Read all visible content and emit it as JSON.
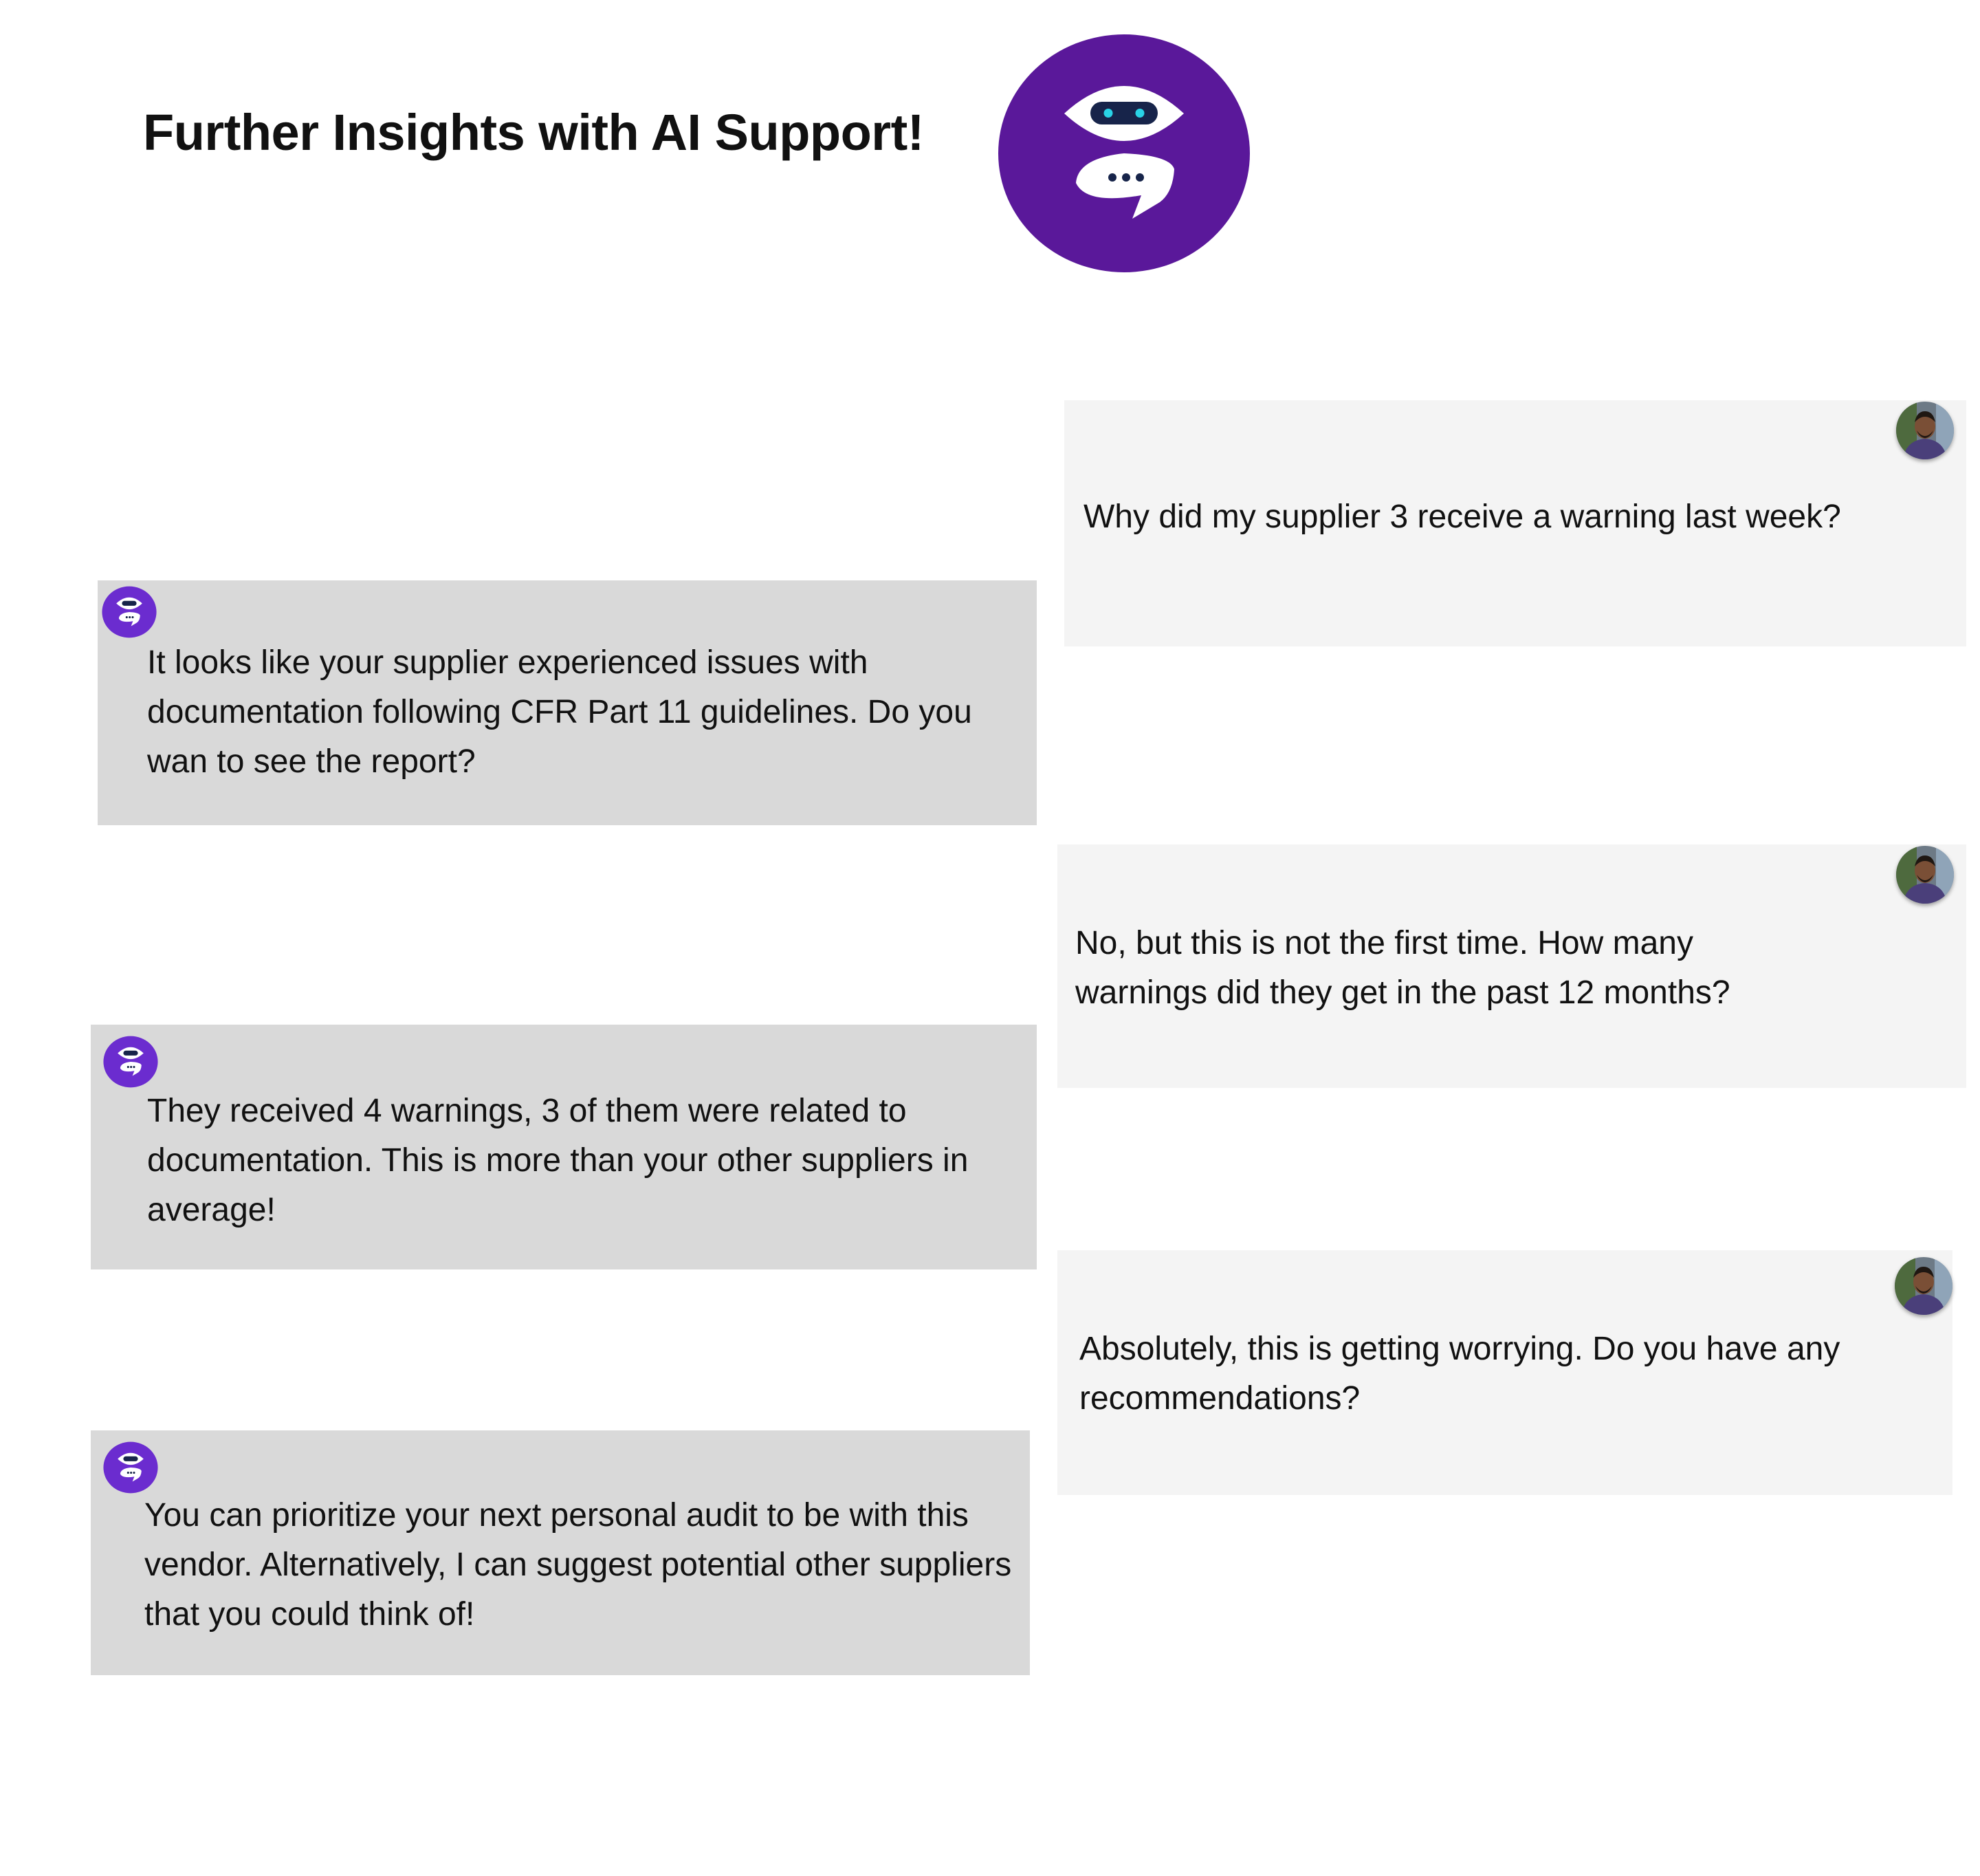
{
  "header": {
    "title": "Further Insights with AI Support!",
    "logo_icon": "chatbot-robot-icon",
    "brand_color": "#5a189a"
  },
  "conversation": {
    "messages": [
      {
        "role": "user",
        "avatar_icon": "user-photo-avatar",
        "text": "Why did my supplier 3 receive a warning last week?"
      },
      {
        "role": "assistant",
        "avatar_icon": "chatbot-robot-icon",
        "text": "It looks like your supplier experienced issues with documentation following CFR Part 11 guidelines. Do you wan to see the report?"
      },
      {
        "role": "user",
        "avatar_icon": "user-photo-avatar",
        "text": "No, but this is not the first time. How many warnings did they get in the past 12 months?"
      },
      {
        "role": "assistant",
        "avatar_icon": "chatbot-robot-icon",
        "text": "They received 4 warnings, 3 of them were related to documentation. This is more than your other suppliers in average!"
      },
      {
        "role": "user",
        "avatar_icon": "user-photo-avatar",
        "text": "Absolutely, this is getting worrying. Do you have any recommendations?"
      },
      {
        "role": "assistant",
        "avatar_icon": "chatbot-robot-icon",
        "text": "You can prioritize your next personal audit to be with this vendor. Alternatively, I can suggest potential other suppliers that you could think of!"
      }
    ],
    "colors": {
      "user_bubble": "#f4f4f4",
      "assistant_bubble": "#d9d9d9"
    }
  }
}
